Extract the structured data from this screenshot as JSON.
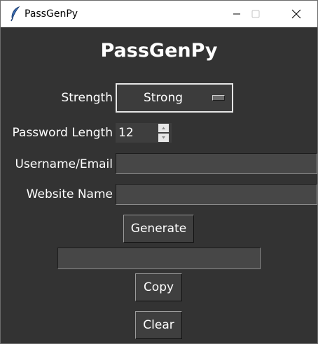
{
  "window": {
    "title": "PassGenPy"
  },
  "main": {
    "heading": "PassGenPy",
    "strength": {
      "label": "Strength",
      "selected": "Strong"
    },
    "length": {
      "label": "Password Length",
      "value": "12"
    },
    "username": {
      "label": "Username/Email",
      "value": ""
    },
    "website": {
      "label": "Website Name",
      "value": ""
    },
    "generate_button": "Generate",
    "password_output": "",
    "copy_button": "Copy",
    "clear_button": "Clear"
  },
  "icons": {
    "app": "feather-icon",
    "minimize": "minimize-icon",
    "maximize": "maximize-icon",
    "close": "close-icon"
  },
  "colors": {
    "background": "#333333",
    "text": "#ffffff",
    "entry_background": "#474747",
    "button_background": "#3f3f3f"
  }
}
